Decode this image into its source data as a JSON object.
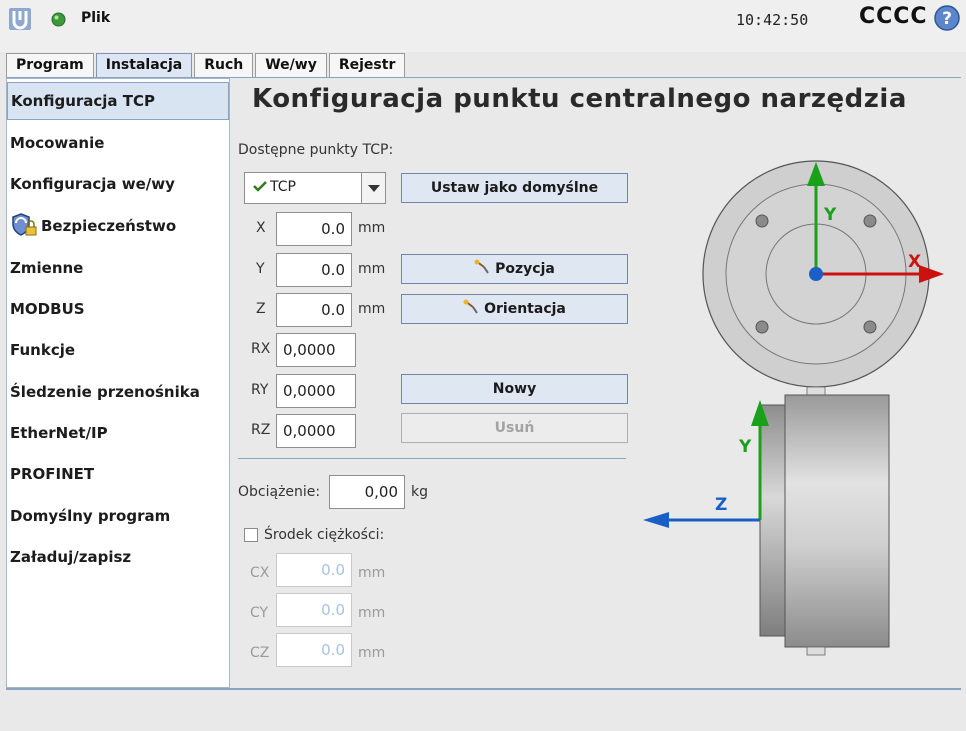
{
  "header": {
    "menu_label": "Plik",
    "time": "10:42:50",
    "robot_name": "CCCC",
    "status_color": "#3a9a3a"
  },
  "tabs": [
    {
      "label": "Program",
      "active": false
    },
    {
      "label": "Instalacja",
      "active": true
    },
    {
      "label": "Ruch",
      "active": false
    },
    {
      "label": "We/wy",
      "active": false
    },
    {
      "label": "Rejestr",
      "active": false
    }
  ],
  "sidebar": {
    "items": [
      {
        "label": "Konfiguracja TCP",
        "active": true
      },
      {
        "label": "Mocowanie"
      },
      {
        "label": "Konfiguracja we/wy"
      },
      {
        "label": "Bezpieczeństwo",
        "icon": "safety-shield-lock-icon"
      },
      {
        "label": "Zmienne"
      },
      {
        "label": "MODBUS"
      },
      {
        "label": "Funkcje"
      },
      {
        "label": "Śledzenie przenośnika"
      },
      {
        "label": "EtherNet/IP"
      },
      {
        "label": "PROFINET"
      },
      {
        "label": "Domyślny program"
      },
      {
        "label": "Załaduj/zapisz"
      }
    ]
  },
  "main": {
    "title": "Konfiguracja punktu centralnego narzędzia",
    "available_label": "Dostępne punkty TCP:",
    "tcp_selected": "TCP",
    "set_default_label": "Ustaw jako domyślne",
    "position_button": "Pozycja",
    "orientation_button": "Orientacja",
    "new_button": "Nowy",
    "delete_button": "Usuń",
    "unit_mm": "mm",
    "unit_kg": "kg",
    "coords": [
      {
        "label": "X",
        "value": "0.0"
      },
      {
        "label": "Y",
        "value": "0.0"
      },
      {
        "label": "Z",
        "value": "0.0"
      },
      {
        "label": "RX",
        "value": "0,0000"
      },
      {
        "label": "RY",
        "value": "0,0000"
      },
      {
        "label": "RZ",
        "value": "0,0000"
      }
    ],
    "payload_label": "Obciążenie:",
    "payload_value": "0,00",
    "cog_label": "Środek ciężkości:",
    "cog_checked": false,
    "cog": [
      {
        "label": "CX",
        "value": "0.0"
      },
      {
        "label": "CY",
        "value": "0.0"
      },
      {
        "label": "CZ",
        "value": "0.0"
      }
    ],
    "diagram_axes": {
      "x": "X",
      "y_top": "Y",
      "y_side": "Y",
      "z": "Z"
    }
  }
}
